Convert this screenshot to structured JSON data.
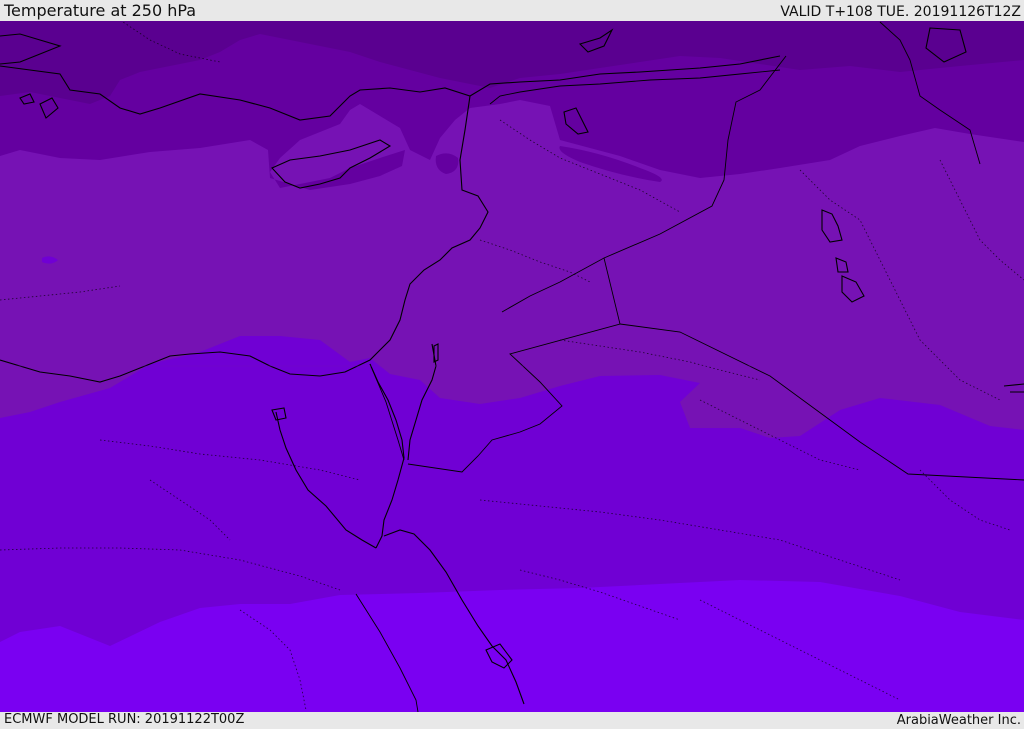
{
  "header": {
    "title": "Temperature at 250 hPa",
    "valid": "VALID T+108 TUE. 20191126T12Z"
  },
  "footer": {
    "model_run": "ECMWF MODEL RUN: 20191122T00Z",
    "credit": "ArabiaWeather Inc."
  },
  "map": {
    "colors": {
      "band_1": "#5a0090",
      "band_2": "#6400a0",
      "band_3": "#7612b4",
      "band_4": "#7000d4",
      "band_5": "#7a00f2",
      "coast": "#000000",
      "border": "#000000"
    }
  }
}
